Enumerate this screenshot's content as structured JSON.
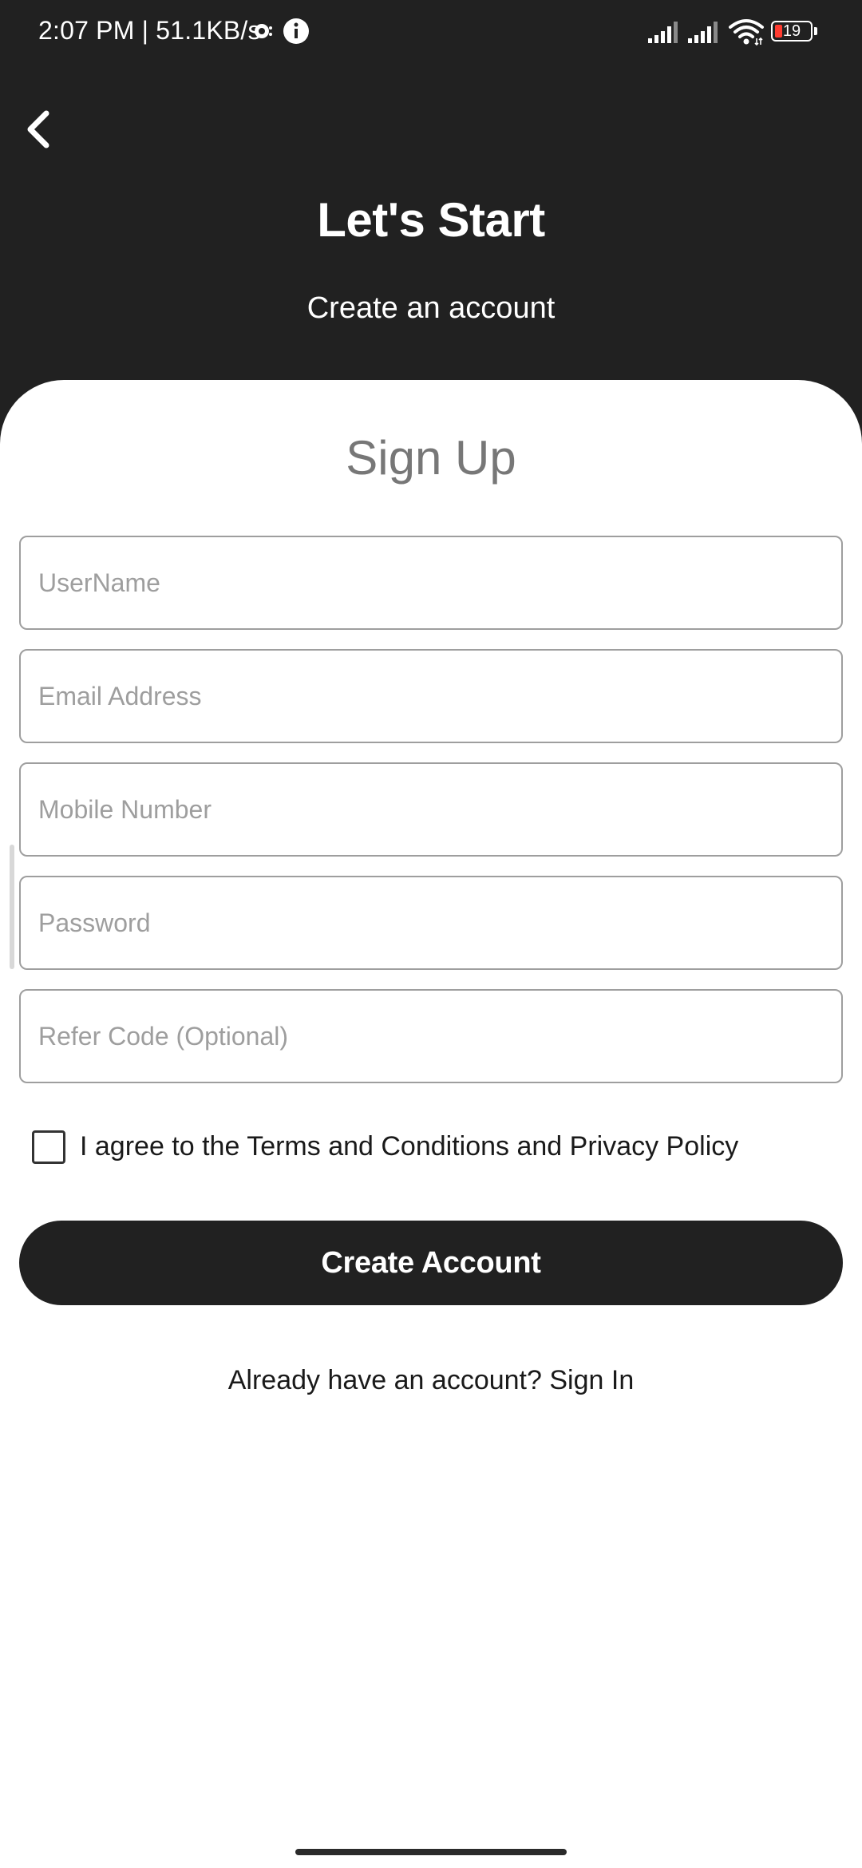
{
  "status_bar": {
    "time": "2:07 PM | 51.1KB/s",
    "battery": "19",
    "icons": [
      "data-saver-icon",
      "info-icon",
      "signal-icon",
      "signal-icon",
      "wifi-icon",
      "battery-icon"
    ],
    "battery_low_color": "#ff3b30"
  },
  "header": {
    "back_icon": "chevron-left-icon",
    "title": "Let's Start",
    "subtitle": "Create an account",
    "background": "#212121"
  },
  "form": {
    "title": "Sign Up",
    "fields": [
      {
        "name": "username",
        "placeholder": "UserName",
        "value": ""
      },
      {
        "name": "email",
        "placeholder": "Email Address",
        "value": ""
      },
      {
        "name": "mobile",
        "placeholder": "Mobile Number",
        "value": ""
      },
      {
        "name": "password",
        "placeholder": "Password",
        "value": ""
      },
      {
        "name": "refer_code",
        "placeholder": "Refer Code (Optional)",
        "value": ""
      }
    ],
    "agree": {
      "checked": false,
      "label": "I agree to the Terms and Conditions and Privacy Policy"
    },
    "submit_label": "Create Account",
    "signin_prompt": "Already have an account?",
    "signin_link": "Sign In"
  }
}
